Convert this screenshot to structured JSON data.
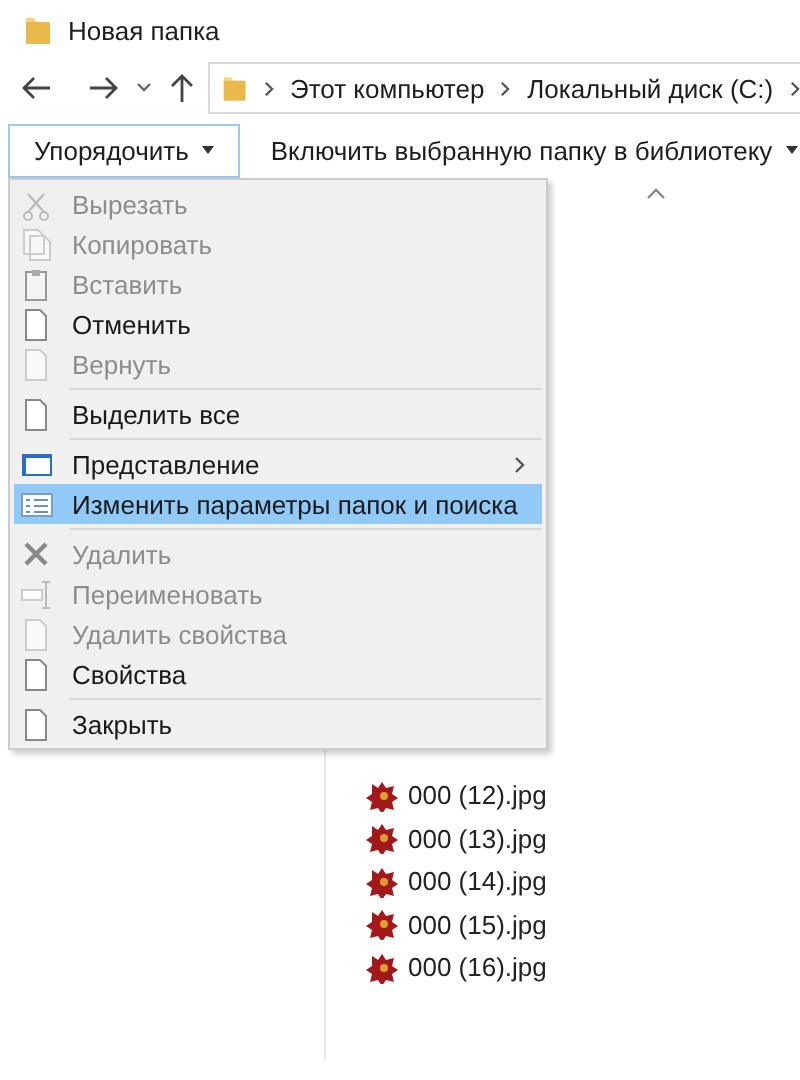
{
  "window": {
    "title": "Новая папка"
  },
  "address_bar": {
    "segments": [
      "Этот компьютер",
      "Локальный диск (C:)"
    ]
  },
  "toolbar": {
    "buttons": [
      {
        "label": "Упорядочить",
        "selected": true
      },
      {
        "label": "Включить выбранную папку в библиотеку",
        "selected": false
      }
    ]
  },
  "context_menu": {
    "items": [
      {
        "kind": "item",
        "label": "Вырезать",
        "disabled": true,
        "selected": false
      },
      {
        "kind": "item",
        "label": "Копировать",
        "disabled": true,
        "selected": false
      },
      {
        "kind": "item",
        "label": "Вставить",
        "disabled": true,
        "selected": false
      },
      {
        "kind": "item",
        "label": "Отменить",
        "disabled": false,
        "selected": false
      },
      {
        "kind": "item",
        "label": "Вернуть",
        "disabled": true,
        "selected": false
      },
      {
        "kind": "separator"
      },
      {
        "kind": "item",
        "label": "Выделить все",
        "disabled": false,
        "selected": false
      },
      {
        "kind": "separator"
      },
      {
        "kind": "submenu",
        "label": "Представление",
        "disabled": false,
        "selected": false
      },
      {
        "kind": "item",
        "label": "Изменить параметры папок и поиска",
        "disabled": false,
        "selected": true
      },
      {
        "kind": "separator"
      },
      {
        "kind": "item",
        "label": "Удалить",
        "disabled": true,
        "selected": false
      },
      {
        "kind": "item",
        "label": "Переименовать",
        "disabled": true,
        "selected": false
      },
      {
        "kind": "item",
        "label": "Удалить свойства",
        "disabled": true,
        "selected": false
      },
      {
        "kind": "item",
        "label": "Свойства",
        "disabled": false,
        "selected": false
      },
      {
        "kind": "separator"
      },
      {
        "kind": "item",
        "label": "Закрыть",
        "disabled": false,
        "selected": false
      }
    ]
  },
  "files": [
    {
      "name": "000 (12).jpg"
    },
    {
      "name": "000 (13).jpg"
    },
    {
      "name": "000 (14).jpg"
    },
    {
      "name": "000 (15).jpg"
    },
    {
      "name": "000 (16).jpg"
    }
  ]
}
